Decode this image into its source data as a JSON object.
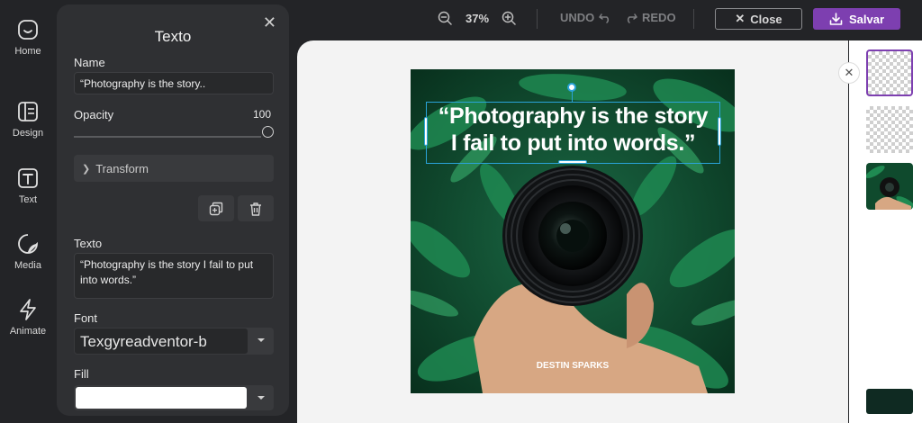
{
  "nav": {
    "items": [
      {
        "label": "Home",
        "icon": "home-icon"
      },
      {
        "label": "Design",
        "icon": "design-icon"
      },
      {
        "label": "Text",
        "icon": "text-icon"
      },
      {
        "label": "Media",
        "icon": "media-icon"
      },
      {
        "label": "Animate",
        "icon": "animate-icon"
      }
    ]
  },
  "panel": {
    "title": "Texto",
    "name_label": "Name",
    "name_value": "“Photography is the story..",
    "opacity_label": "Opacity",
    "opacity_value": "100",
    "transform_label": "Transform",
    "text_label": "Texto",
    "text_value": "“Photography is the story I fail to put into words.”",
    "font_label": "Font",
    "font_value": "Texgyreadventor-b",
    "fill_label": "Fill",
    "fill_color": "#ffffff"
  },
  "toolbar": {
    "zoom": "37%",
    "undo": "UNDO",
    "redo": "REDO",
    "close": "Close",
    "save": "Salvar"
  },
  "canvas": {
    "quote": "“Photography is the story\nI fail to put into words.”",
    "credit": "DESTIN SPARKS",
    "selection_color": "#2aa3d9"
  },
  "rail": {
    "background_color": "#0f2a22"
  },
  "colors": {
    "accent": "#7d3fb0",
    "panel_bg": "#2f3033",
    "app_bg": "#232427"
  }
}
